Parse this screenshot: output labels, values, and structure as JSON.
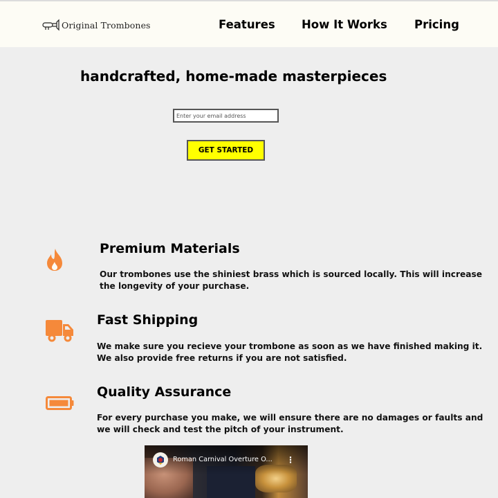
{
  "header": {
    "logo_text": "Original Trombones",
    "logo_icon": "trombone-icon",
    "nav": [
      {
        "label": "Features"
      },
      {
        "label": "How It Works"
      },
      {
        "label": "Pricing"
      }
    ]
  },
  "hero": {
    "title": "handcrafted, home-made masterpieces",
    "email_placeholder": "Enter your email address",
    "cta_label": "GET STARTED"
  },
  "features": [
    {
      "icon": "fire-icon",
      "title": "Premium Materials",
      "description": "Our trombones use the shiniest brass which is sourced locally. This will increase the longevity of your purchase."
    },
    {
      "icon": "truck-icon",
      "title": "Fast Shipping",
      "description": "We make sure you recieve your trombone as soon as we have finished making it. We also provide free returns if you are not satisfied."
    },
    {
      "icon": "battery-icon",
      "title": "Quality Assurance",
      "description": "For every purchase you make, we will ensure there are no damages or faults and we will check and test the pitch of your instrument."
    }
  ],
  "video": {
    "title": "Roman Carnival Overture O...",
    "menu_icon": "more-vertical-icon"
  },
  "colors": {
    "page_background": "#eeeeee",
    "header_background": "#fdfcf5",
    "accent_orange": "#f5893a",
    "cta_yellow": "#ffff00"
  }
}
